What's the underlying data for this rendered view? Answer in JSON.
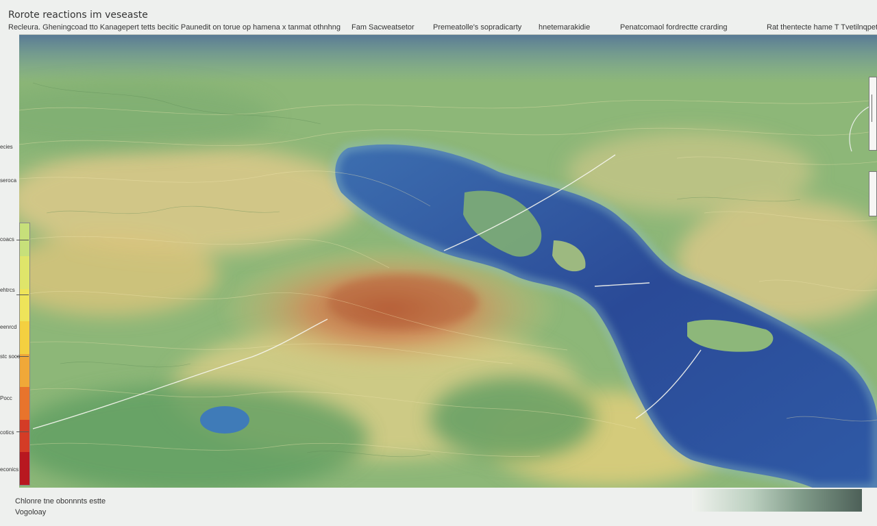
{
  "title": "Rorote reactions im veseaste",
  "subheader": [
    "Recleura. Gheningcoad tto Kanagepert tetts becitic Paunedit on torue op hamena x tanmat othnhng",
    "Fam Sacweatsetor",
    "Premeatolle's sopradicarty",
    "hnetemarakidie",
    "Penatcomaol fordrectte crarding",
    "Rat thentecte hame T Tvetilnqpeti"
  ],
  "side_labels": [
    "ecies",
    "seroca",
    "coacs",
    "ehtrcs",
    "eenrcd",
    "stc soco",
    "Pocc",
    "cotics",
    "econics"
  ],
  "legend_colors": [
    "#c7e07a",
    "#dfe56a",
    "#eee45a",
    "#f4d040",
    "#f0a838",
    "#e8742c",
    "#d43c26",
    "#b81820"
  ],
  "bottom_caption": [
    "Chlonre tne obonnnts estte",
    "Vogoloay"
  ],
  "map": {
    "colors": {
      "land_green": "#7fb071",
      "land_yellow": "#dcc97e",
      "land_orange": "#cd8a55",
      "water_deep": "#2d4f9d",
      "water_mid": "#3f79b6",
      "water_shallow": "#7fb3c6"
    }
  }
}
